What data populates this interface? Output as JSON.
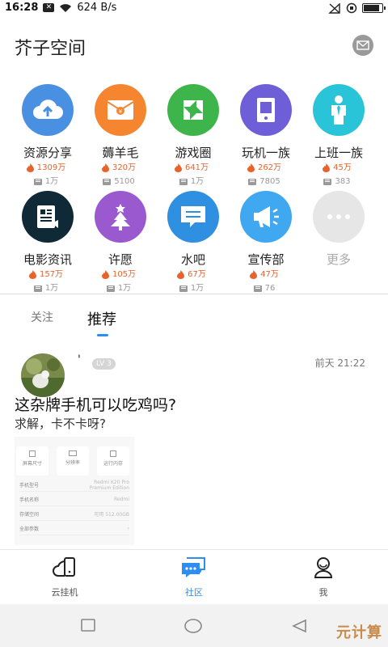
{
  "status_bar": {
    "time": "16:28",
    "x_badge": "✕",
    "speed": "624 B/s",
    "battery_level": 0.9
  },
  "header": {
    "title": "芥子空间",
    "mail_icon": "mail-icon"
  },
  "categories": [
    {
      "name": "资源分享",
      "hot": "1309万",
      "count": "1万",
      "icon": "cloud-upload-icon",
      "color": "#4a90e2"
    },
    {
      "name": "薅羊毛",
      "hot": "320万",
      "count": "5100",
      "icon": "red-envelope-icon",
      "color": "#f5862f"
    },
    {
      "name": "游戏圈",
      "hot": "641万",
      "count": "1万",
      "icon": "game-square-icon",
      "color": "#3db54a"
    },
    {
      "name": "玩机一族",
      "hot": "262万",
      "count": "7805",
      "icon": "phone-icon",
      "color": "#6e5fd8"
    },
    {
      "name": "上班一族",
      "hot": "45万",
      "count": "383",
      "icon": "office-worker-icon",
      "color": "#29c4d8"
    },
    {
      "name": "电影资讯",
      "hot": "157万",
      "count": "1万",
      "icon": "film-icon",
      "color": "#0f2a36"
    },
    {
      "name": "许愿",
      "hot": "105万",
      "count": "1万",
      "icon": "tree-icon",
      "color": "#9b59d0"
    },
    {
      "name": "水吧",
      "hot": "67万",
      "count": "1万",
      "icon": "message-icon",
      "color": "#2f8fe0"
    },
    {
      "name": "宣传部",
      "hot": "47万",
      "count": "76",
      "icon": "megaphone-icon",
      "color": "#3fa8f0"
    },
    {
      "name": "更多",
      "hot": "",
      "count": "",
      "icon": "more-dots-icon",
      "color": "#e6e6e6"
    }
  ],
  "tabs": [
    {
      "label": "关注"
    },
    {
      "label": "推荐"
    }
  ],
  "post": {
    "user": "'",
    "level": "3",
    "level_prefix": "LV",
    "time": "前天 21:22",
    "title": "这杂牌手机可以吃鸡吗?",
    "body": "求解，卡不卡呀?",
    "image_rows": [
      {
        "label": "手机型号",
        "value": "Redmi K20 Pro Premium Edition"
      },
      {
        "label": "手机名称",
        "value": "Redmi"
      },
      {
        "label": "存储空间",
        "value": "可用 512.00GB"
      },
      {
        "label": "全部参数",
        "value": ""
      }
    ],
    "image_boxes": [
      "屏幕尺寸",
      "分辨率",
      "运行内存"
    ]
  },
  "bottom_nav": [
    {
      "label": "云挂机",
      "icon": "cloud-phone-icon"
    },
    {
      "label": "社区",
      "icon": "community-chat-icon"
    },
    {
      "label": "我",
      "icon": "profile-icon"
    }
  ],
  "colors": {
    "accent": "#2d8ef0",
    "hot": "#e8632c"
  },
  "watermark": "元计算"
}
